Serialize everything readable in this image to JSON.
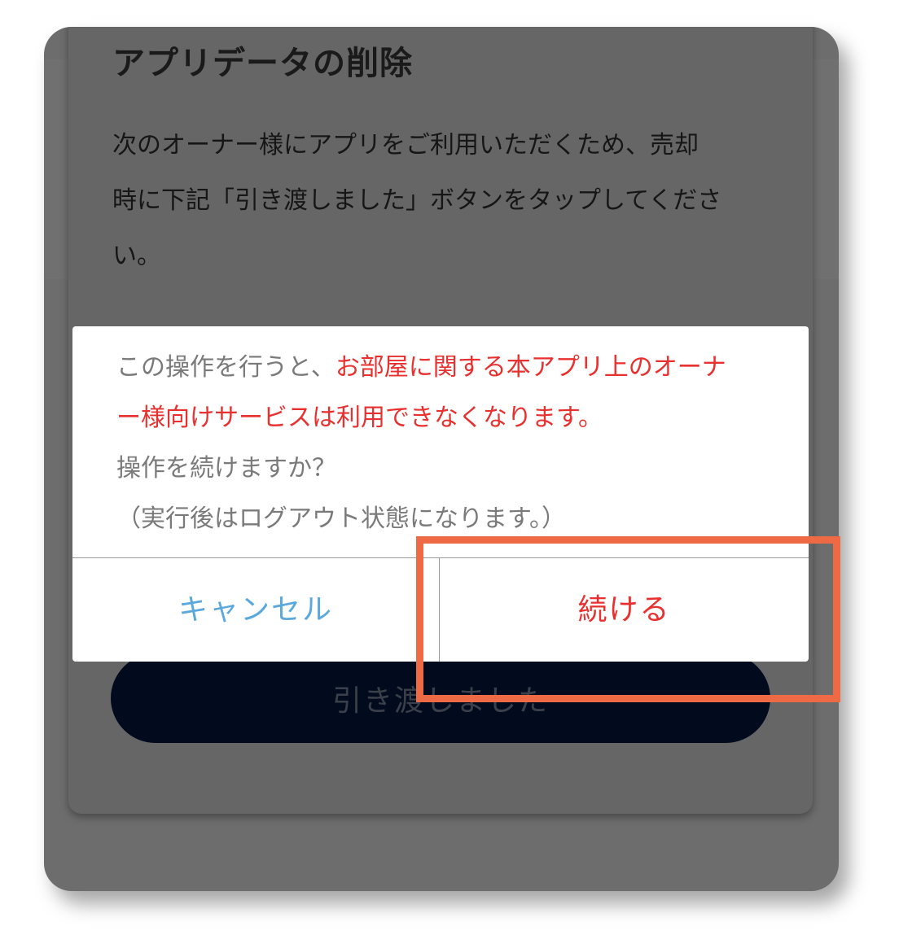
{
  "card": {
    "title": "アプリデータの削除",
    "description_lines": [
      "次のオーナー様にアプリをご利用いただくため、売却",
      "時に下記「引き渡しました」ボタンをタップしてくださ",
      "い。"
    ],
    "handover_button_label": "引き渡しました"
  },
  "dialog": {
    "line1_normal": "この操作を行うと、",
    "line1_red": "お部屋に関する本アプリ上のオーナ",
    "line2_red": "ー様向けサービスは利用できなくなります。",
    "line3": "操作を続けますか？",
    "line4": "（実行後はログアウト状態になります。）",
    "cancel_label": "キャンセル",
    "continue_label": "続ける"
  },
  "colors": {
    "warning_red": "#e8302f",
    "cancel_blue": "#5aa8dc",
    "highlight_orange": "#ee6a44",
    "overlay_gray": "#6d6d6d"
  }
}
